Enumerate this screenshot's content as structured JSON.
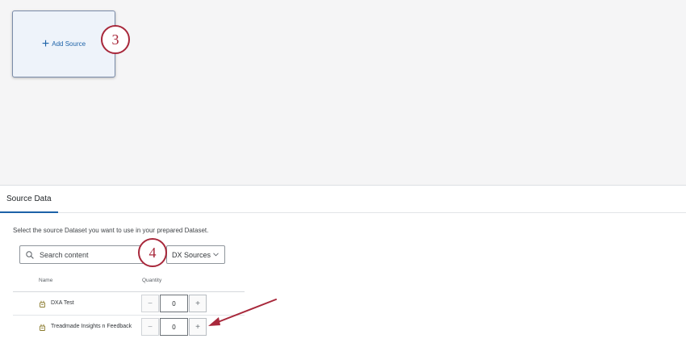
{
  "canvas": {
    "add_source_label": "Add Source",
    "add_icon": "plus-icon",
    "step_badges": [
      "3",
      "4"
    ]
  },
  "source_data": {
    "title": "Source Data",
    "instructions": "Select the source Dataset you want to use in your prepared Dataset.",
    "search": {
      "placeholder": "Search content",
      "value": ""
    },
    "source_filter": {
      "selected": "DX Sources"
    },
    "columns": [
      "Name",
      "Quantity"
    ],
    "rows": [
      {
        "name": "DXA Test",
        "quantity": "0",
        "icon": "survey-icon"
      },
      {
        "name": "Treadmade Insights n Feedback",
        "quantity": "0",
        "icon": "survey-icon"
      }
    ],
    "stepper_minus": "−",
    "stepper_plus": "+"
  },
  "colors": {
    "accent": "#1d62a8",
    "annotation": "#a8283b"
  }
}
